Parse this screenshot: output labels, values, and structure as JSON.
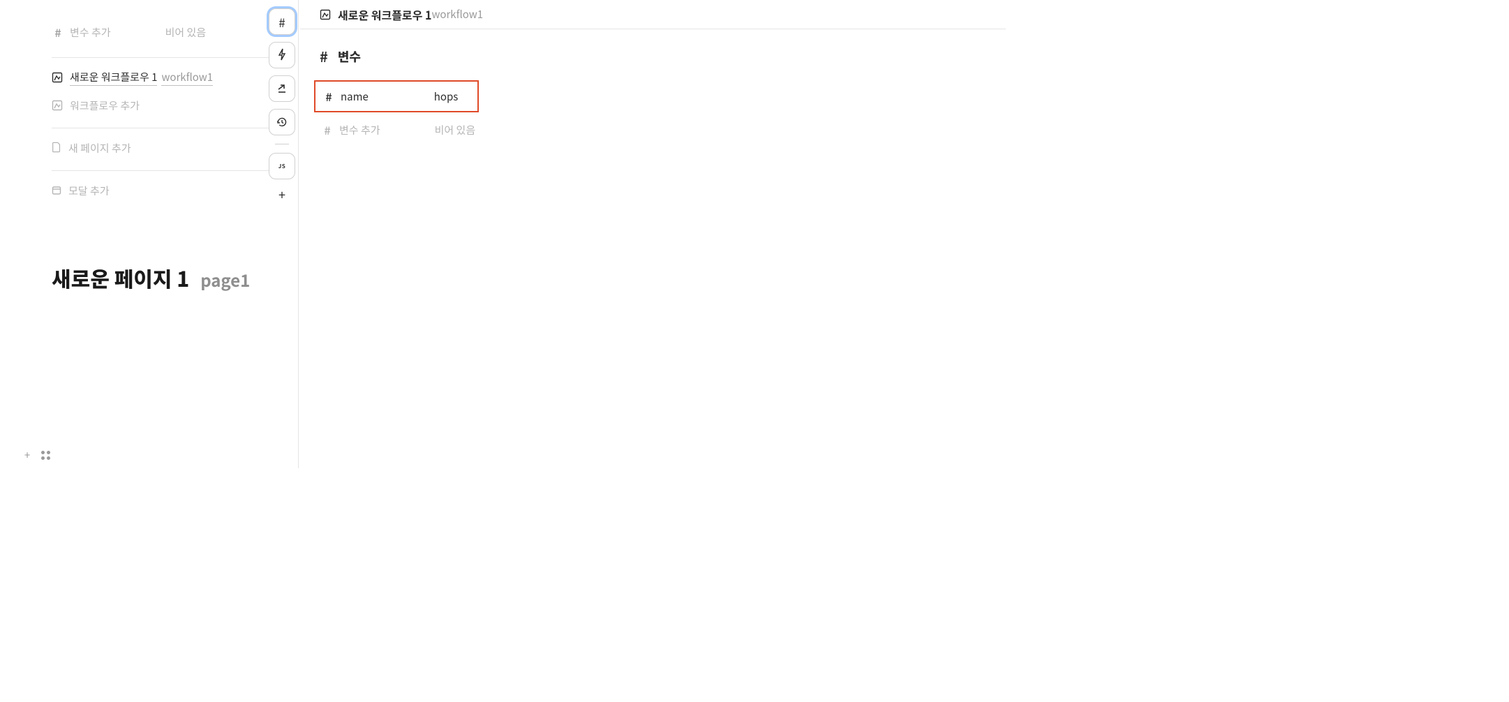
{
  "left": {
    "var_add_label": "변수 추가",
    "var_empty": "비어 있음",
    "workflow_title": "새로운 워크플로우 1",
    "workflow_id": "workflow1",
    "workflow_add": "워크플로우 추가",
    "page_add": "새 페이지 추가",
    "modal_add": "모달 추가"
  },
  "page_header": {
    "title": "새로운 페이지 1",
    "id": "page1"
  },
  "toolbar": {
    "hash": "#",
    "js": "JS",
    "plus": "+"
  },
  "right": {
    "header_title": "새로운 워크플로우 1",
    "header_id": "workflow1",
    "section_hash": "#",
    "section_title": "변수",
    "var_key": "name",
    "var_val": "hops",
    "var_add_label": "변수 추가",
    "var_empty": "비어 있음"
  },
  "icons": {
    "hash": "#"
  }
}
